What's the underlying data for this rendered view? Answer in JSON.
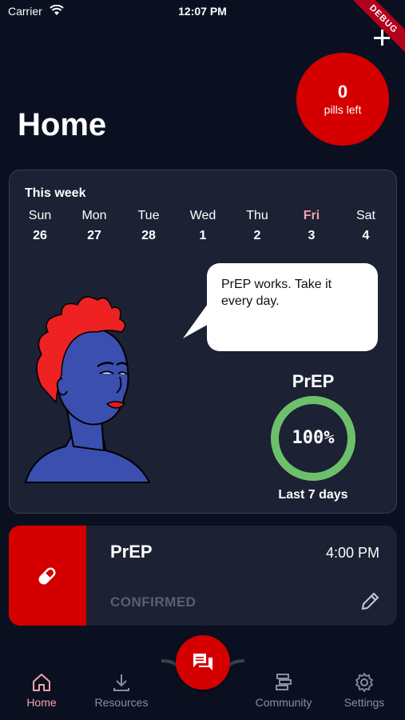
{
  "status_bar": {
    "carrier": "Carrier",
    "time": "12:07 PM",
    "debug": "DEBUG"
  },
  "pills": {
    "count": "0",
    "label": "pills left"
  },
  "page": {
    "title": "Home"
  },
  "week": {
    "title": "This week",
    "days": [
      {
        "name": "Sun",
        "date": "26"
      },
      {
        "name": "Mon",
        "date": "27"
      },
      {
        "name": "Tue",
        "date": "28"
      },
      {
        "name": "Wed",
        "date": "1"
      },
      {
        "name": "Thu",
        "date": "2"
      },
      {
        "name": "Fri",
        "date": "3"
      },
      {
        "name": "Sat",
        "date": "4"
      }
    ],
    "today_index": 5
  },
  "message": {
    "text": "PrEP works. Take it every day."
  },
  "adherence": {
    "label": "PrEP",
    "value": "100%",
    "fraction": 1.0,
    "caption": "Last 7 days",
    "ring_color": "#6cc06c"
  },
  "reminder": {
    "name": "PrEP",
    "time": "4:00 PM",
    "status": "CONFIRMED"
  },
  "nav": {
    "items": [
      {
        "label": "Home",
        "icon": "home-icon"
      },
      {
        "label": "Resources",
        "icon": "download-icon"
      },
      {
        "label": "Community",
        "icon": "community-icon"
      },
      {
        "label": "Settings",
        "icon": "gear-icon"
      }
    ],
    "fab_icon": "chat-icon"
  },
  "colors": {
    "accent": "#d40000",
    "background": "#0b1021",
    "card": "#1c2133",
    "highlight": "#f2a3a8"
  }
}
